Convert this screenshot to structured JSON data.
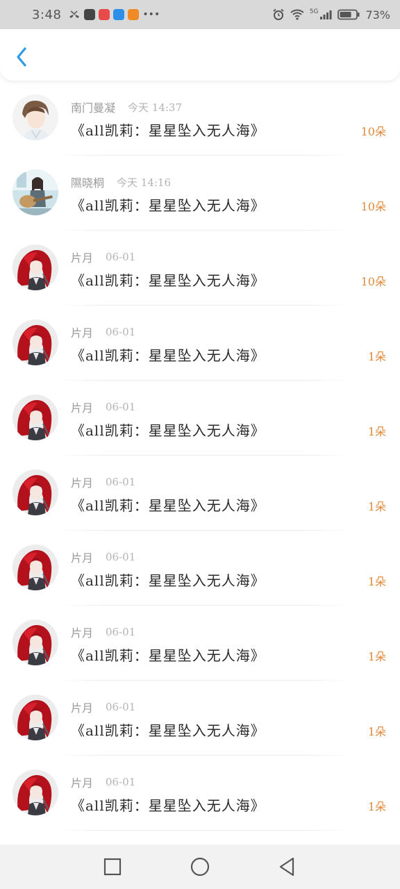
{
  "status_bar": {
    "time": "3:48",
    "battery_percent": "73%",
    "network_label": "5G",
    "battery_level": 0.73,
    "app_icon_colors": [
      "#444444",
      "#e84a4a",
      "#2e8fe8",
      "#f08a24"
    ]
  },
  "header": {
    "back_icon": "chevron-left-icon",
    "accent_color": "#2e9be6"
  },
  "list": {
    "items": [
      {
        "username": "南门曼凝",
        "time": "今天 14:37",
        "title": "《all凯莉：星星坠入无人海》",
        "count": "10朵",
        "avatar": "avatar-male-anime"
      },
      {
        "username": "隰晓桐",
        "time": "今天 14:16",
        "title": "《all凯莉：星星坠入无人海》",
        "count": "10朵",
        "avatar": "avatar-guitar-girl"
      },
      {
        "username": "片月",
        "time": "06-01",
        "title": "《all凯莉：星星坠入无人海》",
        "count": "10朵",
        "avatar": "avatar-red-hair"
      },
      {
        "username": "片月",
        "time": "06-01",
        "title": "《all凯莉：星星坠入无人海》",
        "count": "1朵",
        "avatar": "avatar-red-hair"
      },
      {
        "username": "片月",
        "time": "06-01",
        "title": "《all凯莉：星星坠入无人海》",
        "count": "1朵",
        "avatar": "avatar-red-hair"
      },
      {
        "username": "片月",
        "time": "06-01",
        "title": "《all凯莉：星星坠入无人海》",
        "count": "1朵",
        "avatar": "avatar-red-hair"
      },
      {
        "username": "片月",
        "time": "06-01",
        "title": "《all凯莉：星星坠入无人海》",
        "count": "1朵",
        "avatar": "avatar-red-hair"
      },
      {
        "username": "片月",
        "time": "06-01",
        "title": "《all凯莉：星星坠入无人海》",
        "count": "1朵",
        "avatar": "avatar-red-hair"
      },
      {
        "username": "片月",
        "time": "06-01",
        "title": "《all凯莉：星星坠入无人海》",
        "count": "1朵",
        "avatar": "avatar-red-hair"
      },
      {
        "username": "片月",
        "time": "06-01",
        "title": "《all凯莉：星星坠入无人海》",
        "count": "1朵",
        "avatar": "avatar-red-hair"
      }
    ]
  },
  "nav_bar": {
    "recent_icon": "square-icon",
    "home_icon": "circle-icon",
    "back_icon": "triangle-back-icon"
  }
}
